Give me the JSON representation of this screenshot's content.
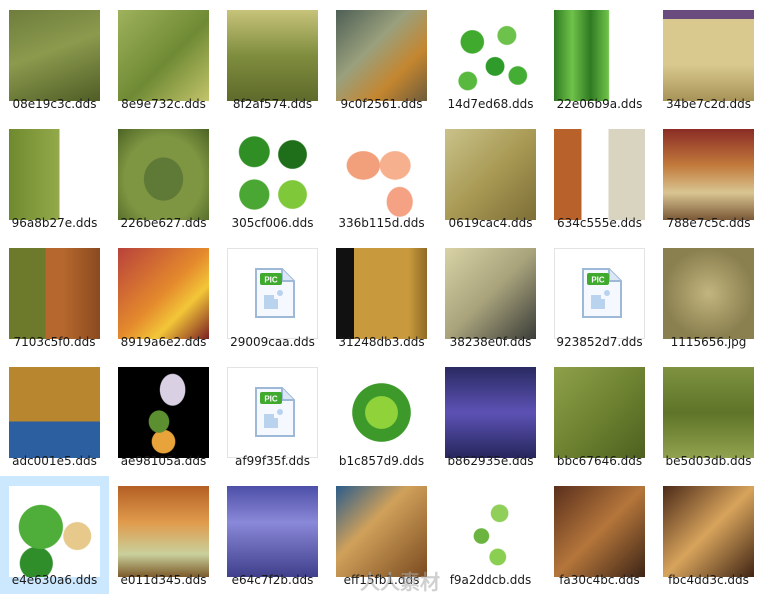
{
  "files": [
    {
      "name": "08e19c3c.dds",
      "type": "texture",
      "bg": "linear-gradient(160deg,#6e7d3c,#8b9a4d 45%,#4f5d26)"
    },
    {
      "name": "8e9e732c.dds",
      "type": "texture",
      "bg": "linear-gradient(135deg,#9fb15c,#6f8a34 55%,#c3c46b)"
    },
    {
      "name": "8f2af574.dds",
      "type": "texture",
      "bg": "linear-gradient(180deg,#c7c37a,#7f8d3e 50%,#5e6a2a)"
    },
    {
      "name": "9c0f2561.dds",
      "type": "texture",
      "bg": "linear-gradient(135deg,#4e5f55,#9aa07d 40%,#c4862f 70%,#6e5b3b)"
    },
    {
      "name": "14d7ed68.dds",
      "type": "texture",
      "bg": "radial-gradient(circle at 30% 35%,#3faa2e 0 13%,transparent 14%),radial-gradient(circle at 68% 28%,#6cc24a 0 10%,transparent 11%),radial-gradient(circle at 55% 62%,#2f9b2a 0 12%,transparent 13%),radial-gradient(circle at 25% 78%,#58b93e 0 9%,transparent 10%),radial-gradient(circle at 80% 72%,#44ad33 0 9%,transparent 10%),#ffffff"
    },
    {
      "name": "22e06b9a.dds",
      "type": "texture",
      "bg": "linear-gradient(90deg,#2f7a22,#6fc24a 20%,#2f7a22 40%,#6fc24a 60%,#ffffff 61%)"
    },
    {
      "name": "34be7c2d.dds",
      "type": "texture",
      "bg": "linear-gradient(180deg,#6a4b7e 0 10%,#d9c98e 10% 60%,#a89357)"
    },
    {
      "name": "96a8b27e.dds",
      "type": "texture",
      "bg": "linear-gradient(90deg,#6f8a2e,#93a94a 55%,#ffffff 56%)"
    },
    {
      "name": "226be627.dds",
      "type": "texture",
      "bg": "radial-gradient(ellipse at 50% 55%,#5f7a36 0 30%,#7e9542 31% 60%,#4c6424)"
    },
    {
      "name": "305cf006.dds",
      "type": "texture",
      "bg": "radial-gradient(circle at 30% 25%,#2f8f24 0 16%,transparent 17%),radial-gradient(circle at 72% 28%,#1f6f1a 0 15%,transparent 16%),radial-gradient(circle at 30% 72%,#4aa733 0 16%,transparent 17%),radial-gradient(circle at 72% 72%,#7ec83a 0 15%,transparent 16%),#ffffff"
    },
    {
      "name": "336b115d.dds",
      "type": "texture",
      "bg": "radial-gradient(ellipse at 30% 40%,#f2a07c 0 18%,transparent 19%),radial-gradient(ellipse at 65% 40%,#f7b08e 0 18%,transparent 19%),radial-gradient(ellipse at 70% 80%,#f4a283 0 14%,transparent 15%),#ffffff"
    },
    {
      "name": "0619cac4.dds",
      "type": "texture",
      "bg": "linear-gradient(135deg,#c9c28a,#a99a55 50%,#7d6e36)"
    },
    {
      "name": "634c555e.dds",
      "type": "texture",
      "bg": "linear-gradient(90deg,#b8612a 0 30%,#ffffff 30% 60%,#d8d4c0 60%)"
    },
    {
      "name": "788e7c5c.dds",
      "type": "texture",
      "bg": "linear-gradient(180deg,#8a2c26,#c27a3b 40%,#d9c592 70%,#7a5836)"
    },
    {
      "name": "7103c5f0.dds",
      "type": "texture",
      "bg": "linear-gradient(90deg,#6d7a2c 0 40%,#b5672d 40% 60%,#8a4a1f)"
    },
    {
      "name": "8919a6e2.dds",
      "type": "texture",
      "bg": "linear-gradient(135deg,#b8423b,#e48a2d 50%,#f3c638 70%,#7a1f22)"
    },
    {
      "name": "29009caa.dds",
      "type": "pic",
      "bg": "#ffffff"
    },
    {
      "name": "31248db3.dds",
      "type": "texture",
      "bg": "linear-gradient(90deg,#111111 0 20%,#c89a3d 20% 80%,#8f6a26)"
    },
    {
      "name": "38238e0f.dds",
      "type": "texture",
      "bg": "linear-gradient(135deg,#d8d2a6,#a9a37c 50%,#3a3c38)"
    },
    {
      "name": "923852d7.dds",
      "type": "pic",
      "bg": "#ffffff"
    },
    {
      "name": "1115656.jpg",
      "type": "texture",
      "bg": "radial-gradient(circle at 50% 50%,#c2b57f,#8a7f4f 70%)"
    },
    {
      "name": "adc001e5.dds",
      "type": "texture",
      "bg": "linear-gradient(180deg,#b8862e 0 60%,#2b5fa0 60%)"
    },
    {
      "name": "ae98105a.dds",
      "type": "texture",
      "bg": "radial-gradient(ellipse at 60% 25%,#d9d0e4 0 16%,transparent 17%),radial-gradient(ellipse at 45% 60%,#5c8f2f 0 14%,transparent 15%),radial-gradient(circle at 50% 82%,#e8a43a 0 13%,transparent 14%),#000000"
    },
    {
      "name": "af99f35f.dds",
      "type": "pic",
      "bg": "#ffffff"
    },
    {
      "name": "b1c857d9.dds",
      "type": "texture",
      "bg": "radial-gradient(circle at 50% 50%,#8fd23a 0 25%,#3d9a2a 26% 45%,#ffffff 46%)"
    },
    {
      "name": "b862935e.dds",
      "type": "texture",
      "bg": "linear-gradient(180deg,#2a2a62,#5d52b5 50%,#26265c)"
    },
    {
      "name": "bbc67646.dds",
      "type": "texture",
      "bg": "linear-gradient(135deg,#8fa04a,#6e8331 50%,#4e6020)"
    },
    {
      "name": "be5d03db.dds",
      "type": "texture",
      "bg": "linear-gradient(180deg,#7e9241,#5f7428 50%,#91a24f)"
    },
    {
      "name": "e4e630a6.dds",
      "type": "texture",
      "bg": "radial-gradient(circle at 35% 45%,#4fae3a 0 28%,transparent 29%),radial-gradient(circle at 30% 85%,#2f8d2a 0 16%,transparent 17%),radial-gradient(circle at 75% 55%,#e6c98b 0 16%,transparent 17%),#ffffff"
    },
    {
      "name": "e011d345.dds",
      "type": "texture",
      "bg": "linear-gradient(180deg,#b45f25,#e09b4c 40%,#c9d09c 75%,#7c5a2a)"
    },
    {
      "name": "e64c7f2b.dds",
      "type": "texture",
      "bg": "linear-gradient(180deg,#4d4fa8,#8a88d8 40%,#3f3f8c)"
    },
    {
      "name": "eff15fb1.dds",
      "type": "texture",
      "bg": "linear-gradient(135deg,#2b5c8a,#d0a15a 40%,#7a4a20)"
    },
    {
      "name": "f9a2ddcb.dds",
      "type": "texture",
      "bg": "radial-gradient(circle at 60% 30%,#8fcf5a 0 10%,transparent 11%),radial-gradient(circle at 40% 55%,#6ab43f 0 10%,transparent 11%),radial-gradient(circle at 58% 78%,#8bcf52 0 9%,transparent 10%),#ffffff"
    },
    {
      "name": "fa30c4bc.dds",
      "type": "texture",
      "bg": "linear-gradient(135deg,#5a2f1c,#b5763b 50%,#3c2416)"
    },
    {
      "name": "fbc4dd3c.dds",
      "type": "texture",
      "bg": "linear-gradient(135deg,#4b2a18,#d8a45c 50%,#3f2414)"
    }
  ],
  "selected_index": 28,
  "pic_icon_label": "PIC",
  "watermark": "人人素材"
}
